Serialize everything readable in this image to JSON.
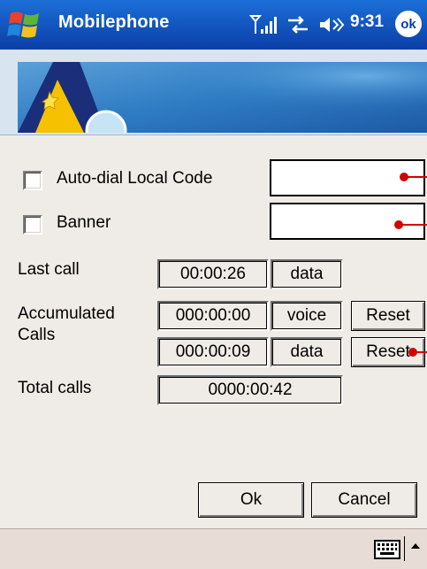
{
  "titlebar": {
    "app_title": "Mobilephone",
    "clock": "9:31",
    "ok_label": "ok"
  },
  "options": {
    "autodial_label": "Auto-dial Local Code",
    "autodial_checked": false,
    "autodial_value": "",
    "banner_label": "Banner",
    "banner_checked": false,
    "banner_value": ""
  },
  "stats": {
    "last_call_label": "Last call",
    "last_call_time": "00:00:26",
    "last_call_type": "data",
    "accumulated_label_line1": "Accumulated",
    "accumulated_label_line2": "Calls",
    "acc_voice_time": "000:00:00",
    "acc_voice_type": "voice",
    "acc_data_time": "000:00:09",
    "acc_data_type": "data",
    "reset_label": "Reset",
    "total_calls_label": "Total calls",
    "total_calls_time": "0000:00:42"
  },
  "actions": {
    "ok_label": "Ok",
    "cancel_label": "Cancel"
  },
  "colors": {
    "titlebar": "#1c6fd8",
    "background": "#efebe7",
    "annotation_red": "#d40000"
  }
}
